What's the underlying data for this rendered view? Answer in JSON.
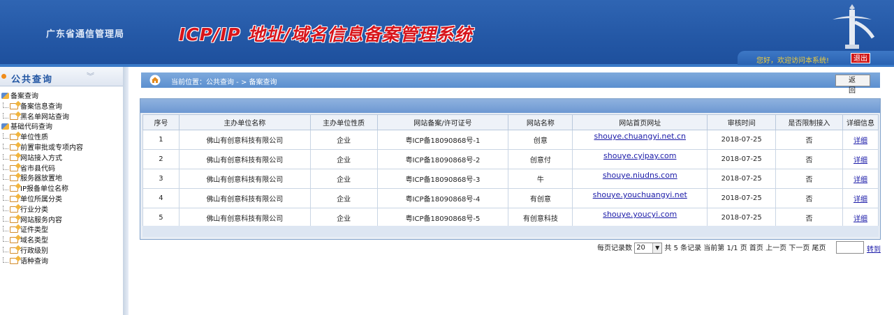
{
  "header": {
    "agency": "广东省通信管理局",
    "system_title": "ICP/IP 地址/域名信息备案管理系统",
    "welcome": "您好，欢迎访问本系统!",
    "logout_label": "退出"
  },
  "sidebar": {
    "title": "公共查询",
    "tree": [
      {
        "type": "group",
        "label": "备案查询"
      },
      {
        "type": "leaf",
        "label": "备案信息查询"
      },
      {
        "type": "leaf",
        "label": "黑名单网站查询"
      },
      {
        "type": "group",
        "label": "基础代码查询"
      },
      {
        "type": "leaf",
        "label": "单位性质"
      },
      {
        "type": "leaf",
        "label": "前置审批或专项内容"
      },
      {
        "type": "leaf",
        "label": "网站接入方式"
      },
      {
        "type": "leaf",
        "label": "省市县代码"
      },
      {
        "type": "leaf",
        "label": "服务器放置地"
      },
      {
        "type": "leaf",
        "label": "IP报备单位名称"
      },
      {
        "type": "leaf",
        "label": "单位所属分类"
      },
      {
        "type": "leaf",
        "label": "行业分类"
      },
      {
        "type": "leaf",
        "label": "网站服务内容"
      },
      {
        "type": "leaf",
        "label": "证件类型"
      },
      {
        "type": "leaf",
        "label": "域名类型"
      },
      {
        "type": "leaf",
        "label": "行政级别"
      },
      {
        "type": "leaf",
        "label": "语种查询"
      }
    ]
  },
  "breadcrumb": {
    "text": "当前位置：公共查询 - > 备案查询",
    "back_label": "返 回"
  },
  "table": {
    "headers": [
      "序号",
      "主办单位名称",
      "主办单位性质",
      "网站备案/许可证号",
      "网站名称",
      "网站首页网址",
      "审核时间",
      "是否限制接入",
      "详细信息"
    ],
    "rows": [
      {
        "no": "1",
        "org": "佛山有创意科技有限公司",
        "nature": "企业",
        "license": "粤ICP备18090868号-1",
        "site": "创意",
        "url": "shouye.chuangyi.net.cn",
        "date": "2018-07-25",
        "restricted": "否",
        "detail": "详细"
      },
      {
        "no": "2",
        "org": "佛山有创意科技有限公司",
        "nature": "企业",
        "license": "粤ICP备18090868号-2",
        "site": "创意付",
        "url": "shouye.cyipay.com",
        "date": "2018-07-25",
        "restricted": "否",
        "detail": "详细"
      },
      {
        "no": "3",
        "org": "佛山有创意科技有限公司",
        "nature": "企业",
        "license": "粤ICP备18090868号-3",
        "site": "牛",
        "url": "shouye.niudns.com",
        "date": "2018-07-25",
        "restricted": "否",
        "detail": "详细"
      },
      {
        "no": "4",
        "org": "佛山有创意科技有限公司",
        "nature": "企业",
        "license": "粤ICP备18090868号-4",
        "site": "有创意",
        "url": "shouye.youchuangyi.net",
        "date": "2018-07-25",
        "restricted": "否",
        "detail": "详细"
      },
      {
        "no": "5",
        "org": "佛山有创意科技有限公司",
        "nature": "企业",
        "license": "粤ICP备18090868号-5",
        "site": "有创意科技",
        "url": "shouye.youcyi.com",
        "date": "2018-07-25",
        "restricted": "否",
        "detail": "详细"
      }
    ]
  },
  "pager": {
    "per_page_label": "每页记录数",
    "per_page_value": "20",
    "summary": "共 5 条记录  当前第 1/1 页 首页 上一页 下一页 尾页",
    "goto_label": "转到"
  }
}
